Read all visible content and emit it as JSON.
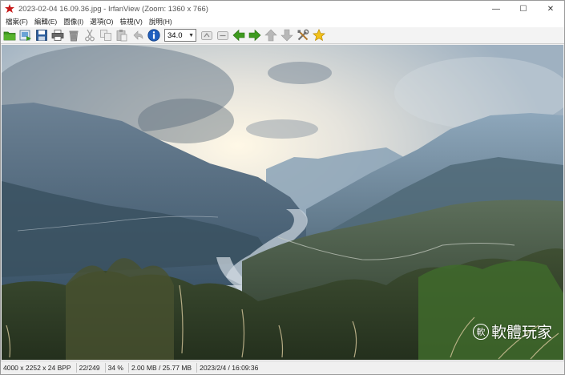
{
  "window": {
    "title": "2023-02-04 16.09.36.jpg - IrfanView (Zoom: 1360 x 766)",
    "minimize": "—",
    "maximize": "☐",
    "close": "✕"
  },
  "menu": {
    "items": [
      "檔案(F)",
      "編輯(E)",
      "圖像(I)",
      "選項(O)",
      "檢視(V)",
      "說明(H)"
    ]
  },
  "toolbar": {
    "zoom_value": "34.0",
    "icons": [
      "open-folder-icon",
      "slideshow-icon",
      "save-icon",
      "print-icon",
      "delete-icon",
      "cut-icon",
      "copy-icon",
      "paste-icon",
      "undo-icon",
      "info-icon",
      "zoom-in-icon",
      "zoom-out-icon",
      "prev-icon",
      "next-icon",
      "first-icon",
      "last-icon",
      "settings-icon",
      "favorite-icon"
    ],
    "colors": {
      "accent_green": "#3e9a1f",
      "info_blue": "#1f5fbf",
      "star": "#f2c11a"
    }
  },
  "status": {
    "cells": [
      "4000 x 2252 x 24 BPP",
      "22/249",
      "34 %",
      "2.00 MB / 25.77 MB",
      "2023/2/4 / 16:09:36"
    ]
  },
  "watermark": {
    "symbol": "軟",
    "text": "軟體玩家"
  }
}
